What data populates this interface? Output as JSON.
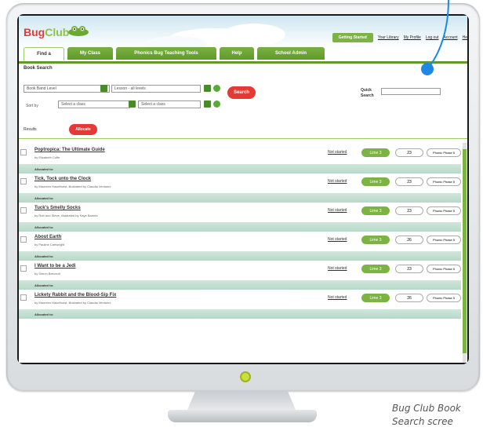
{
  "app": {
    "logo_bug": "Bug",
    "logo_club": "Club"
  },
  "top_nav": {
    "getting_started": "Getting Started",
    "links": [
      "Your Library",
      "My Profile",
      "Log out",
      "Account",
      "He"
    ]
  },
  "tabs": [
    {
      "label": "Find a",
      "active": true
    },
    {
      "label": "My Class",
      "active": false
    },
    {
      "label": "Phonics Bug Teaching Tools",
      "active": false
    },
    {
      "label": "Help",
      "active": false
    },
    {
      "label": "School Admin",
      "active": false
    }
  ],
  "search": {
    "title": "Book Search",
    "book_band_placeholder": "Book Band Level",
    "lesson_placeholder": "Lesson - all levels",
    "sort_label": "Sort by",
    "class_placeholder": "Select a class",
    "class_placeholder_2": "Select a class",
    "search_button": "Search",
    "quick_label": "Quick Search"
  },
  "results": {
    "label": "Results",
    "allocate_button": "Allocate",
    "allocated_label": "Allocated to:"
  },
  "books": [
    {
      "title": "Poptropica: The Ultimate Guide",
      "author": "by Elizabeth Coffe",
      "status": "Not started",
      "level": "Lime 3",
      "number": "23",
      "phase": "Phonic Phase 5"
    },
    {
      "title": "Tick, Tock unto the Clock",
      "author": "by Maureen Haselhurst, illustrated by Claudia Venturini",
      "status": "Not started",
      "level": "Lime 3",
      "number": "23",
      "phase": "Phonic Phase 5"
    },
    {
      "title": "Tuck's Smelly Socks",
      "author": "by Rob and Steve, illustrated by Kaye Barnes",
      "status": "Not started",
      "level": "Lime 3",
      "number": "23",
      "phase": "Phonic Phase 5"
    },
    {
      "title": "About Earth",
      "author": "by Pauline Cartwright",
      "status": "Not started",
      "level": "Lime 3",
      "number": "26",
      "phase": "Phonic Phase 5"
    },
    {
      "title": "I Want to be a Jedi",
      "author": "by Simon Beecroft",
      "status": "Not started",
      "level": "Lime 3",
      "number": "23",
      "phase": "Phonic Phase 5"
    },
    {
      "title": "Lickety Rabbit and the Blood-Sip Fix",
      "author": "by Maureen Haselhurst, illustrated by Claudia Venturini",
      "status": "Not started",
      "level": "Lime 3",
      "number": "26",
      "phase": "Phonic Phase 5"
    }
  ],
  "caption": "Bug Club Book\nSearch scree",
  "colors": {
    "accent_green": "#7cb342",
    "accent_red": "#e53935",
    "pointer_blue": "#1e88e5"
  }
}
